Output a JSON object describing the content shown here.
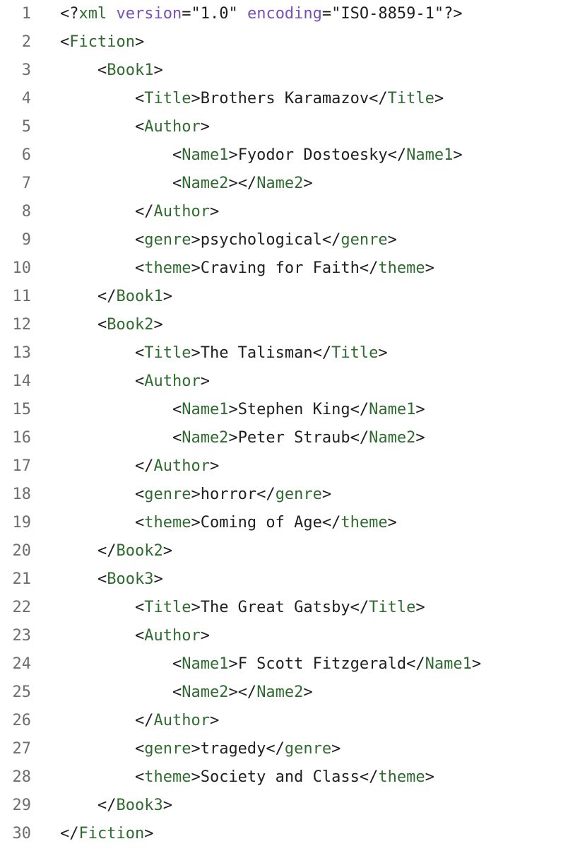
{
  "colors": {
    "background": "#ffffff",
    "line_number": "#6e6e6e",
    "text": "#1f1f1f",
    "tag": "#2e6b2e",
    "attribute": "#7a4fb5"
  },
  "lines": [
    {
      "n": "1",
      "indent": "",
      "kind": "decl",
      "target": "xml",
      "attrs": [
        {
          "name": "version",
          "value": "\"1.0\""
        },
        {
          "name": "encoding",
          "value": "\"ISO-8859-1\""
        }
      ]
    },
    {
      "n": "2",
      "indent": "",
      "kind": "open",
      "tag": "Fiction"
    },
    {
      "n": "3",
      "indent": "    ",
      "kind": "open",
      "tag": "Book1"
    },
    {
      "n": "4",
      "indent": "        ",
      "kind": "elem",
      "tag": "Title",
      "text": "Brothers Karamazov"
    },
    {
      "n": "5",
      "indent": "        ",
      "kind": "open",
      "tag": "Author"
    },
    {
      "n": "6",
      "indent": "            ",
      "kind": "elem",
      "tag": "Name1",
      "text": "Fyodor Dostoesky"
    },
    {
      "n": "7",
      "indent": "            ",
      "kind": "elem",
      "tag": "Name2",
      "text": ""
    },
    {
      "n": "8",
      "indent": "        ",
      "kind": "close",
      "tag": "Author"
    },
    {
      "n": "9",
      "indent": "        ",
      "kind": "elem",
      "tag": "genre",
      "text": "psychological"
    },
    {
      "n": "10",
      "indent": "        ",
      "kind": "elem",
      "tag": "theme",
      "text": "Craving for Faith"
    },
    {
      "n": "11",
      "indent": "    ",
      "kind": "close",
      "tag": "Book1"
    },
    {
      "n": "12",
      "indent": "    ",
      "kind": "open",
      "tag": "Book2"
    },
    {
      "n": "13",
      "indent": "        ",
      "kind": "elem",
      "tag": "Title",
      "text": "The Talisman"
    },
    {
      "n": "14",
      "indent": "        ",
      "kind": "open",
      "tag": "Author"
    },
    {
      "n": "15",
      "indent": "            ",
      "kind": "elem",
      "tag": "Name1",
      "text": "Stephen King"
    },
    {
      "n": "16",
      "indent": "            ",
      "kind": "elem",
      "tag": "Name2",
      "text": "Peter Straub"
    },
    {
      "n": "17",
      "indent": "        ",
      "kind": "close",
      "tag": "Author"
    },
    {
      "n": "18",
      "indent": "        ",
      "kind": "elem",
      "tag": "genre",
      "text": "horror"
    },
    {
      "n": "19",
      "indent": "        ",
      "kind": "elem",
      "tag": "theme",
      "text": "Coming of Age"
    },
    {
      "n": "20",
      "indent": "    ",
      "kind": "close",
      "tag": "Book2"
    },
    {
      "n": "21",
      "indent": "    ",
      "kind": "open",
      "tag": "Book3"
    },
    {
      "n": "22",
      "indent": "        ",
      "kind": "elem",
      "tag": "Title",
      "text": "The Great Gatsby"
    },
    {
      "n": "23",
      "indent": "        ",
      "kind": "open",
      "tag": "Author"
    },
    {
      "n": "24",
      "indent": "            ",
      "kind": "elem",
      "tag": "Name1",
      "text": "F Scott Fitzgerald"
    },
    {
      "n": "25",
      "indent": "            ",
      "kind": "elem",
      "tag": "Name2",
      "text": ""
    },
    {
      "n": "26",
      "indent": "        ",
      "kind": "close",
      "tag": "Author"
    },
    {
      "n": "27",
      "indent": "        ",
      "kind": "elem",
      "tag": "genre",
      "text": "tragedy"
    },
    {
      "n": "28",
      "indent": "        ",
      "kind": "elem",
      "tag": "theme",
      "text": "Society and Class"
    },
    {
      "n": "29",
      "indent": "    ",
      "kind": "close",
      "tag": "Book3"
    },
    {
      "n": "30",
      "indent": "",
      "kind": "close",
      "tag": "Fiction"
    }
  ]
}
